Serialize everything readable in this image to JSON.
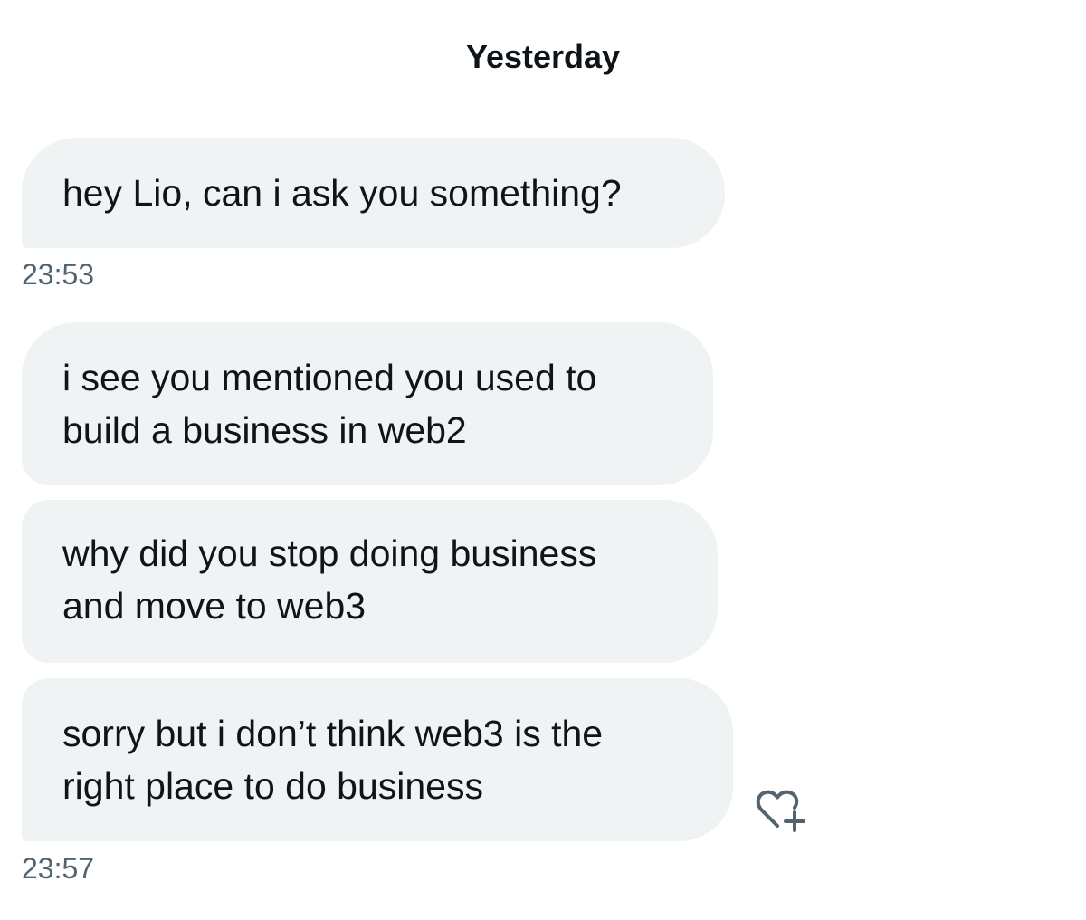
{
  "conversation": {
    "date_separator": "Yesterday",
    "messages": [
      {
        "text": "hey Lio, can i ask you something?"
      },
      {
        "text": "i see you mentioned you used to\nbuild a business in web2"
      },
      {
        "text": "why did you stop doing business\nand move to web3"
      },
      {
        "text": "sorry but i don’t think web3 is the\nright place to do business"
      }
    ],
    "timestamps": [
      "23:53",
      "23:57"
    ],
    "reaction_icon": "heart-plus-icon"
  },
  "colors": {
    "bubble_background": "#eff3f4",
    "text": "#0f1419",
    "secondary_text": "#536471"
  }
}
